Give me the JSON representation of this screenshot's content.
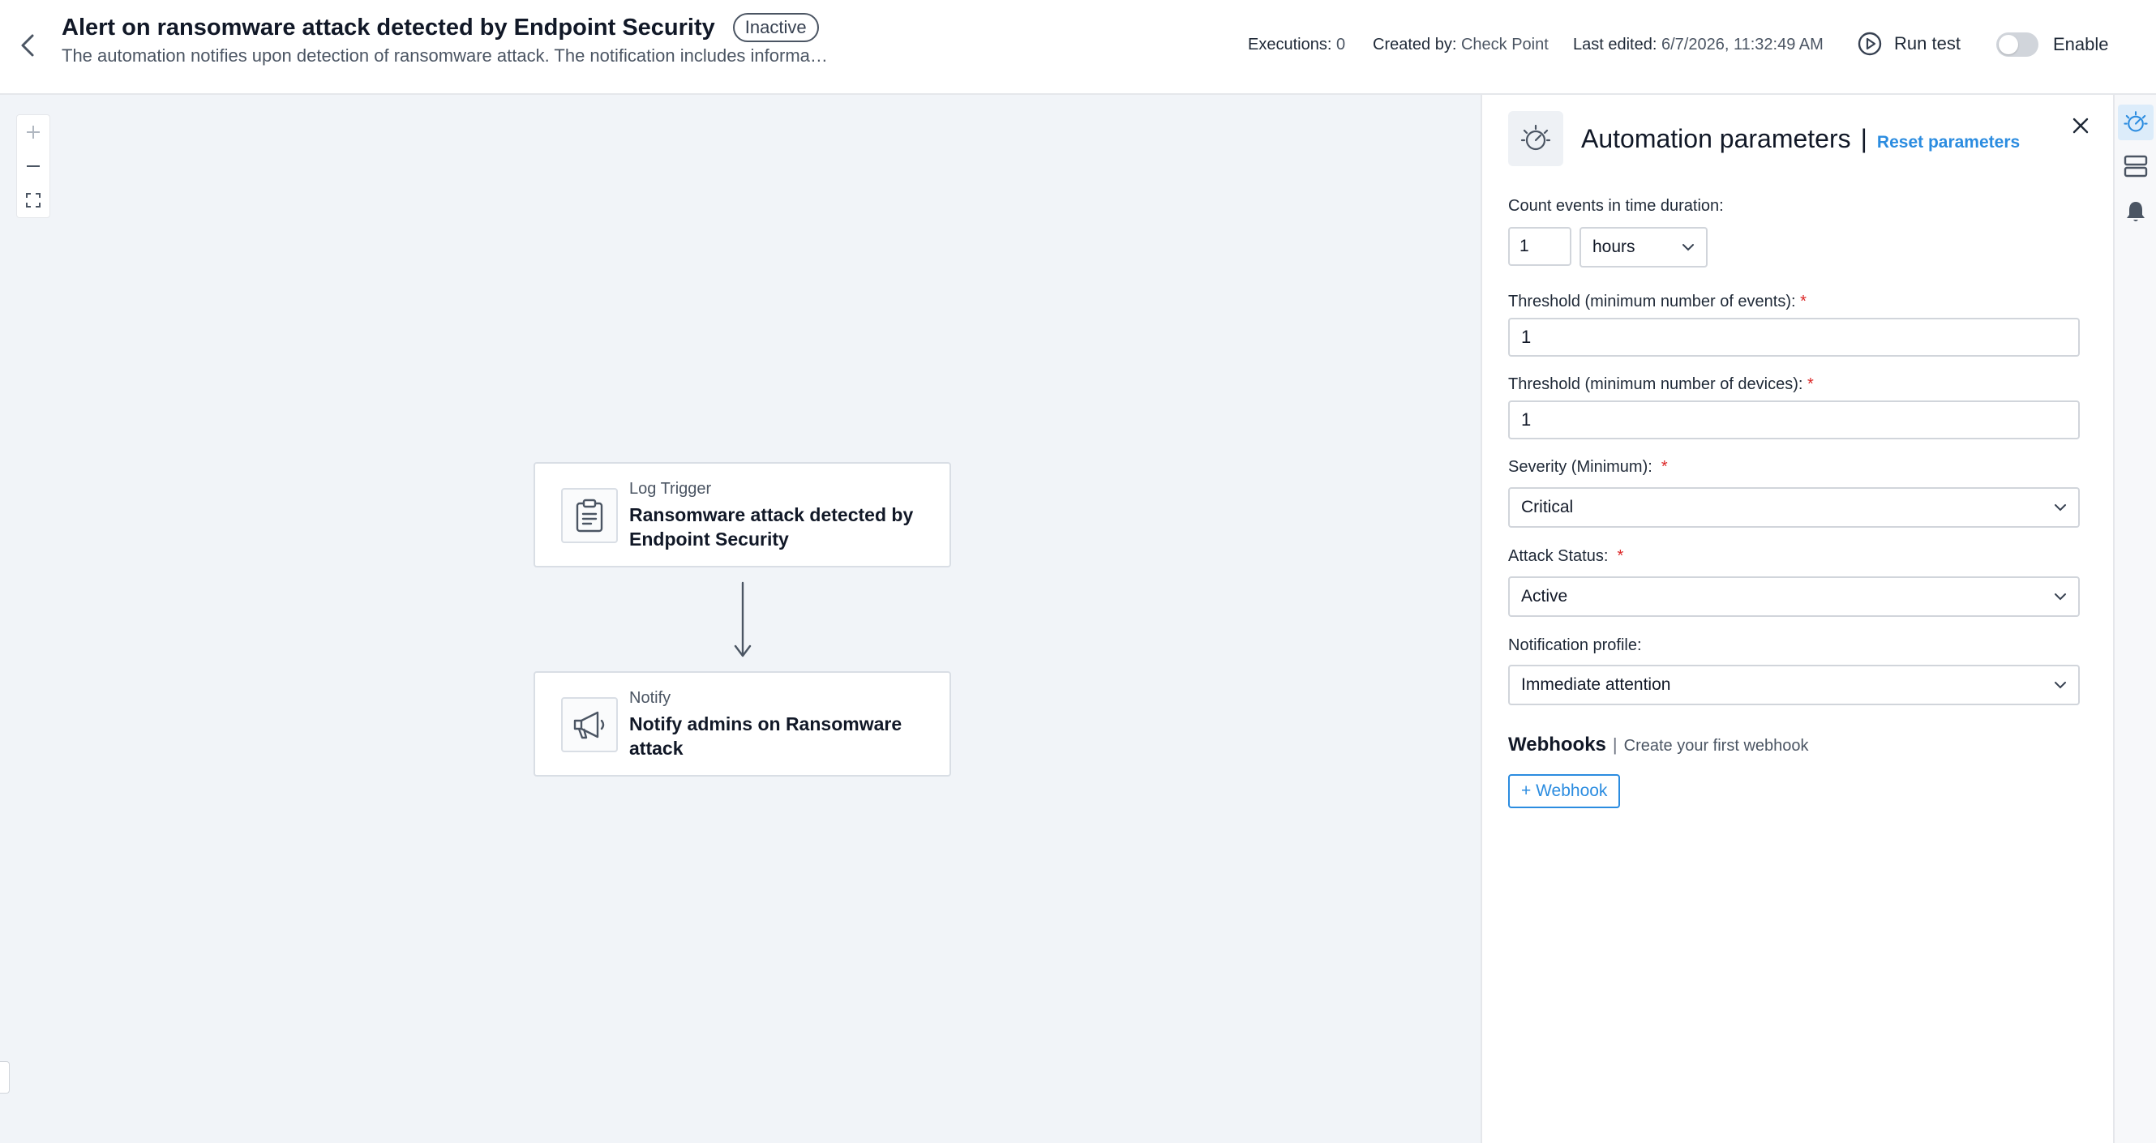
{
  "header": {
    "title": "Alert on ransomware attack detected by Endpoint Security",
    "status": "Inactive",
    "description": "The automation notifies upon detection of ransomware attack. The notification includes informati...",
    "executions_label": "Executions:",
    "executions_value": "0",
    "created_by_label": "Created by:",
    "created_by_value": "Check Point",
    "last_edited_label": "Last edited:",
    "last_edited_value": "6/7/2026, 11:32:49 AM",
    "run_test_label": "Run test",
    "enable_label": "Enable",
    "enabled": false
  },
  "canvas": {
    "nodes": [
      {
        "type": "Log Trigger",
        "name": "Ransomware attack detected by Endpoint Security",
        "icon": "clipboard-icon"
      },
      {
        "type": "Notify",
        "name": "Notify admins on Ransomware attack",
        "icon": "megaphone-icon"
      }
    ],
    "zoom_controls": [
      "zoom-in-icon",
      "zoom-out-icon",
      "fit-screen-icon"
    ]
  },
  "panel": {
    "title": "Automation parameters",
    "separator": "|",
    "reset_label": "Reset parameters",
    "count_events_label": "Count events in time duration:",
    "duration_value": "1",
    "duration_unit": "hours",
    "threshold_events_label": "Threshold (minimum number of events):",
    "threshold_events_value": "1",
    "threshold_devices_label": "Threshold (minimum number of devices):",
    "threshold_devices_value": "1",
    "severity_label": "Severity (Minimum):",
    "severity_value": "Critical",
    "attack_status_label": "Attack Status:",
    "attack_status_value": "Active",
    "notification_profile_label": "Notification profile:",
    "notification_profile_value": "Immediate attention",
    "required_marker": "*",
    "webhooks_title": "Webhooks",
    "webhooks_separator": "|",
    "webhooks_hint": "Create your first webhook",
    "webhook_button_label": "+ Webhook"
  },
  "rail": {
    "items": [
      "automation-icon",
      "layout-icon",
      "bell-icon"
    ],
    "active_index": 0
  },
  "colors": {
    "accent": "#2b8ce0",
    "canvas_bg": "#f1f4f8",
    "required": "#dc2626"
  }
}
